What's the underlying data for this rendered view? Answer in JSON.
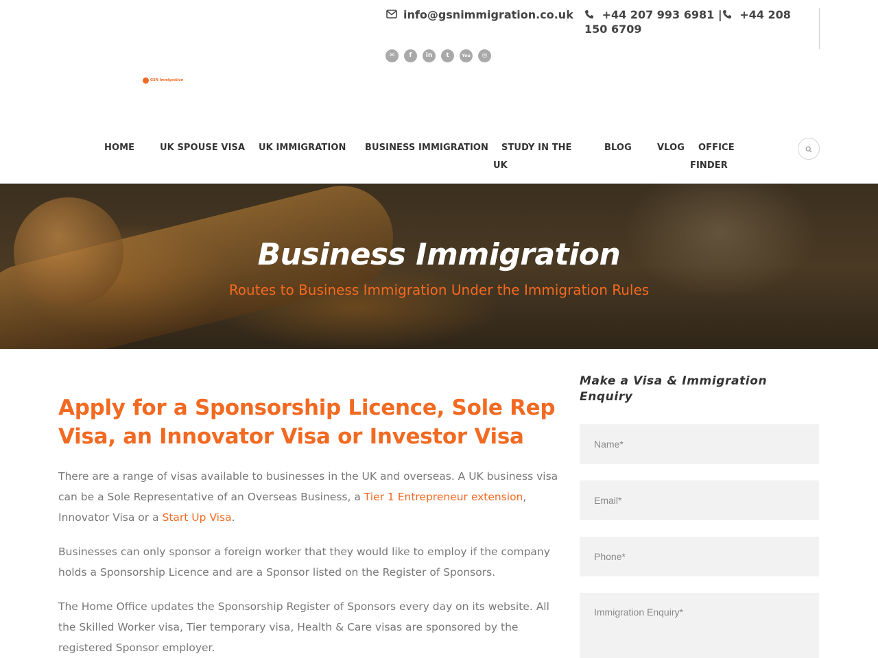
{
  "header": {
    "email": "info@gsnimmigration.co.uk",
    "phone_1": "+44 207 993 6981 |",
    "phone_2": "+44 208 150 6709",
    "social_icons": [
      "email-icon",
      "facebook-icon",
      "linkedin-icon",
      "twitter-icon",
      "youtube-icon",
      "instagram-icon"
    ],
    "social_labels": [
      "✉",
      "f",
      "in",
      "t",
      "You",
      "◎"
    ],
    "logo_text": "GSN Immigration"
  },
  "nav": {
    "items": [
      "HOME",
      "UK SPOUSE VISA",
      "UK IMMIGRATION",
      "BUSINESS IMMIGRATION",
      "STUDY IN THE",
      "UK",
      "BLOG",
      "VLOG",
      "OFFICE",
      "FINDER"
    ]
  },
  "hero": {
    "title": "Business Immigration",
    "subtitle": "Routes to Business Immigration Under the Immigration Rules"
  },
  "main": {
    "heading": "Apply for a Sponsorship Licence, Sole Rep Visa, an Innovator Visa or Investor Visa",
    "p1_part1": "There are a range of visas available to businesses in the UK and overseas. A UK business visa can be a Sole Representative of an Overseas Business, a ",
    "p1_link1": "Tier 1 Entrepreneur extension",
    "p1_part2": ", Innovator Visa or a ",
    "p1_link2": "Start Up Visa",
    "p1_part3": ".",
    "p2": "Businesses can only sponsor a foreign worker that they would like to employ if the company holds a Sponsorship Licence and are a Sponsor listed on the Register of Sponsors.",
    "p3": "The Home Office updates the Sponsorship Register of Sponsors every day on its website. All the Skilled Worker visa, Tier  temporary visa, Health & Care visas are sponsored by the registered Sponsor employer."
  },
  "form": {
    "title": "Make a Visa & Immigration Enquiry",
    "name_placeholder": "Name*",
    "email_placeholder": "Email*",
    "phone_placeholder": "Phone*",
    "enquiry_placeholder": "Immigration Enquiry*"
  },
  "colors": {
    "accent": "#f26a22",
    "text": "#777777",
    "heading": "#333333"
  }
}
